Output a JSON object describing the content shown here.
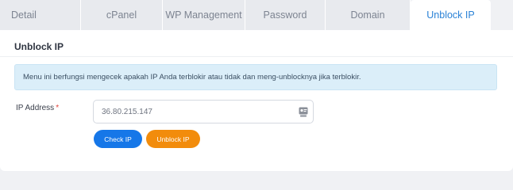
{
  "tabs": [
    {
      "label": "Detail",
      "active": false
    },
    {
      "label": "cPanel",
      "active": false
    },
    {
      "label": "WP Management",
      "active": false
    },
    {
      "label": "Password",
      "active": false
    },
    {
      "label": "Domain",
      "active": false
    },
    {
      "label": "Unblock IP",
      "active": true
    }
  ],
  "card": {
    "title": "Unblock IP",
    "info_message": "Menu ini berfungsi mengecek apakah IP Anda terblokir atau tidak dan meng-unblocknya jika terblokir.",
    "ip_field": {
      "label": "IP Address",
      "required_mark": "*",
      "value": "36.80.215.147",
      "icon": "contact-card-icon"
    },
    "buttons": {
      "check_label": "Check IP",
      "unblock_label": "Unblock IP"
    }
  },
  "colors": {
    "accent": "#2a82d6",
    "check_button": "#1677e8",
    "unblock_button": "#f28c0c",
    "info_bg": "#dbeef9",
    "required": "#e0433a"
  }
}
